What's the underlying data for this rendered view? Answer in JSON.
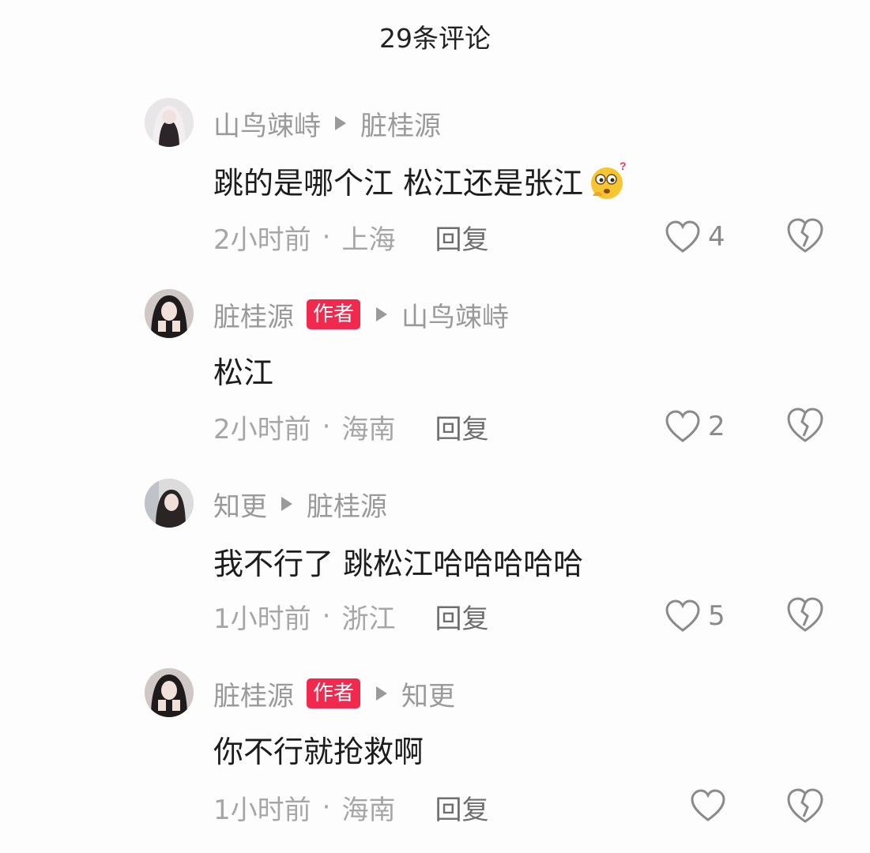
{
  "header": {
    "title": "29条评论"
  },
  "labels": {
    "author_badge": "作者",
    "reply": "回复",
    "separator": "·"
  },
  "comments": [
    {
      "user": "山鸟竦峙",
      "reply_to": "脏桂源",
      "text": "跳的是哪个江 松江还是张江",
      "emoji": "thinking-face-emoji",
      "time": "2小时前",
      "location": "上海",
      "likes": "4"
    },
    {
      "user": "脏桂源",
      "reply_to": "山鸟竦峙",
      "text": "松江",
      "time": "2小时前",
      "location": "海南",
      "likes": "2"
    },
    {
      "user": "知更",
      "reply_to": "脏桂源",
      "text": "我不行了 跳松江哈哈哈哈哈",
      "time": "1小时前",
      "location": "浙江",
      "likes": "5"
    },
    {
      "user": "脏桂源",
      "reply_to": "知更",
      "text": "你不行就抢救啊",
      "time": "1小时前",
      "location": "海南",
      "likes": ""
    }
  ],
  "colors": {
    "badge": "#f2294f",
    "meta": "#a6a6a6",
    "text": "#1c1c1c"
  },
  "icons": {
    "like": "heart-outline-icon",
    "dislike": "broken-heart-icon",
    "reply_arrow": "triangle-right-icon"
  }
}
